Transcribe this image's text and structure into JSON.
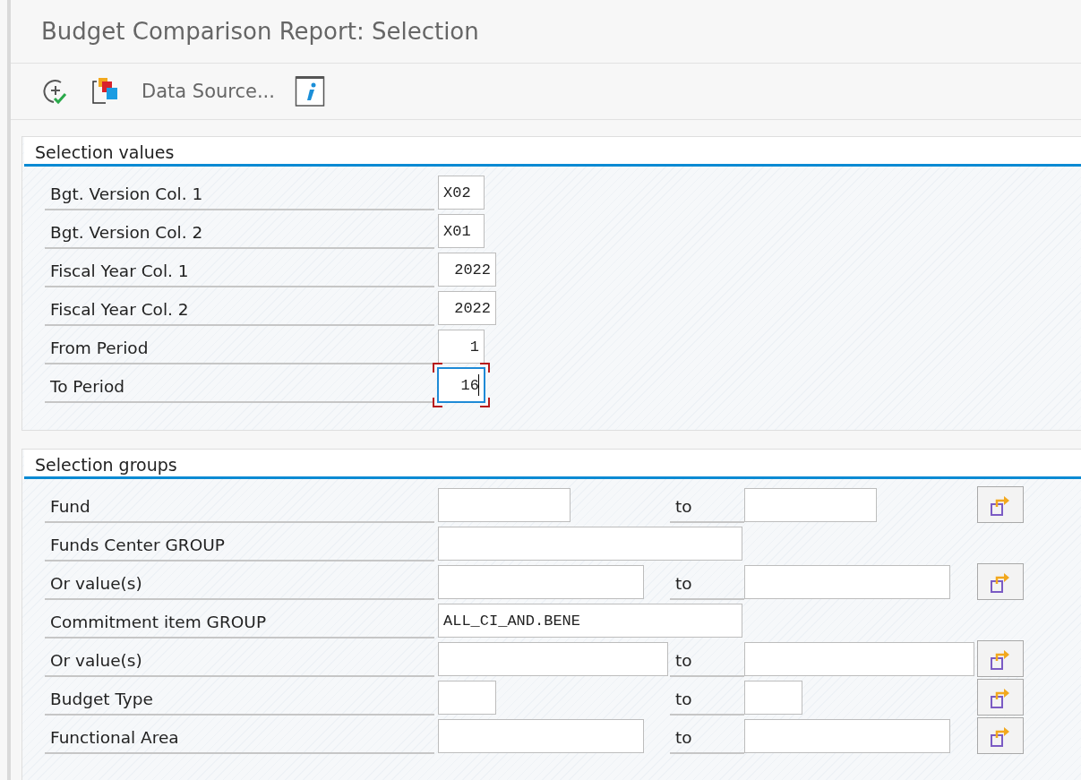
{
  "window": {
    "title": "Budget Comparison Report: Selection"
  },
  "toolbar": [
    {
      "kind": "execute"
    },
    {
      "kind": "layers"
    },
    {
      "kind": "text",
      "label": "Data Source..."
    },
    {
      "kind": "info"
    }
  ],
  "selection_values": {
    "title": "Selection values",
    "rows": [
      {
        "label": "Bgt. Version Col. 1",
        "value": "X02",
        "focused": false
      },
      {
        "label": "Bgt. Version Col. 2",
        "value": "X01",
        "focused": false
      },
      {
        "label": "Fiscal Year Col. 1",
        "value": "2022",
        "focused": false
      },
      {
        "label": "Fiscal Year Col. 2",
        "value": "2022",
        "focused": false
      },
      {
        "label": "From Period",
        "value": "1",
        "focused": false
      },
      {
        "label": "To Period",
        "value": "16",
        "focused": true
      }
    ]
  },
  "selection_groups": {
    "title": "Selection groups",
    "rows": [
      {
        "label": "Fund",
        "kind": "range",
        "to_label": "to"
      },
      {
        "label": "Funds Center GROUP",
        "kind": "single"
      },
      {
        "label": "Or value(s)",
        "kind": "range",
        "to_label": "to"
      },
      {
        "label": "Commitment item GROUP",
        "kind": "single",
        "value": "ALL_CI_AND.BENE"
      },
      {
        "label": "Or value(s)",
        "kind": "range",
        "to_label": "to"
      },
      {
        "label": "Budget Type",
        "kind": "range",
        "to_label": "to"
      },
      {
        "label": "Functional Area",
        "kind": "range",
        "to_label": "to"
      }
    ]
  }
}
